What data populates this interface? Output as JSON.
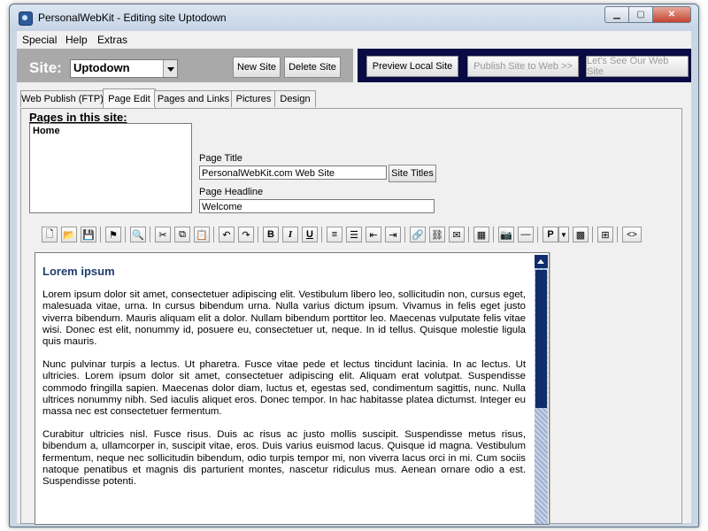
{
  "window": {
    "title": "PersonalWebKit - Editing site Uptodown"
  },
  "window_controls": [
    "minimize-icon",
    "maximize-icon",
    "close-icon"
  ],
  "menu": {
    "items": [
      "Special",
      "Help",
      "Extras"
    ]
  },
  "site": {
    "label": "Site:",
    "selected": "Uptodown",
    "new_button": "New Site",
    "delete_button": "Delete Site"
  },
  "actions": {
    "preview": "Preview Local Site",
    "publish": "Publish Site to Web >>",
    "see": "Let's See Our Web Site"
  },
  "tabs": [
    "Web Publish (FTP)",
    "Page Edit",
    "Pages and Links",
    "Pictures",
    "Design"
  ],
  "active_tab": "Page Edit",
  "pages": {
    "label": "Pages in this site:",
    "items": [
      "Home"
    ]
  },
  "form": {
    "page_title_label": "Page Title",
    "page_title_value": "PersonalWebKit.com Web Site",
    "site_titles_button": "Site Titles",
    "headline_label": "Page Headline",
    "headline_value": "Welcome"
  },
  "toolbar": {
    "icons": [
      "new-file-icon",
      "open-folder-icon",
      "save-icon",
      "publish-icon",
      "print-preview-icon",
      "cut-icon",
      "copy-icon",
      "paste-icon",
      "undo-icon",
      "redo-icon",
      "bold-icon",
      "italic-icon",
      "underline-icon",
      "numbered-list-icon",
      "bullet-list-icon",
      "outdent-icon",
      "indent-icon",
      "link-icon",
      "unlink-icon",
      "email-link-icon",
      "media-icon",
      "image-icon",
      "horizontal-rule-icon",
      "paragraph-style-icon",
      "style-dropdown-icon",
      "color-picker-icon",
      "table-icon",
      "source-code-icon"
    ],
    "bold_glyph": "B",
    "italic_glyph": "I",
    "underline_glyph": "U",
    "paragraph_glyph": "P",
    "source_glyph": "<>"
  },
  "editor": {
    "heading": "Lorem ipsum",
    "paragraphs": [
      "Lorem ipsum dolor sit amet, consectetuer adipiscing elit. Vestibulum libero leo, sollicitudin non, cursus eget, malesuada vitae, urna. In cursus bibendum urna. Nulla varius dictum ipsum. Vivamus in felis eget justo viverra bibendum. Mauris aliquam elit a dolor. Nullam bibendum porttitor leo. Maecenas vulputate felis vitae wisi. Donec est elit, nonummy id, posuere eu, consectetuer ut, neque. In id tellus. Quisque molestie ligula quis mauris.",
      "Nunc pulvinar turpis a lectus. Ut pharetra. Fusce vitae pede et lectus tincidunt lacinia. In ac lectus. Ut ultricies. Lorem ipsum dolor sit amet, consectetuer adipiscing elit. Aliquam erat volutpat. Suspendisse commodo fringilla sapien. Maecenas dolor diam, luctus et, egestas sed, condimentum sagittis, nunc. Nulla ultrices nonummy nibh. Sed iaculis aliquet eros. Donec tempor. In hac habitasse platea dictumst. Integer eu massa nec est consectetuer fermentum.",
      "Curabitur ultricies nisl. Fusce risus. Duis ac risus ac justo mollis suscipit. Suspendisse metus risus, bibendum a, ullamcorper in, suscipit vitae, eros. Duis varius euismod lacus. Quisque id magna. Vestibulum fermentum, neque nec sollicitudin bibendum, odio turpis tempor mi, non viverra lacus orci in mi. Cum sociis natoque penatibus et magnis dis parturient montes, nascetur ridiculus mus. Aenean ornare odio a est. Suspendisse potenti."
    ]
  },
  "colors": {
    "navy_bar": "#0a0a45",
    "heading": "#1f3f6e",
    "scrollbar": "#0f2d6b"
  }
}
